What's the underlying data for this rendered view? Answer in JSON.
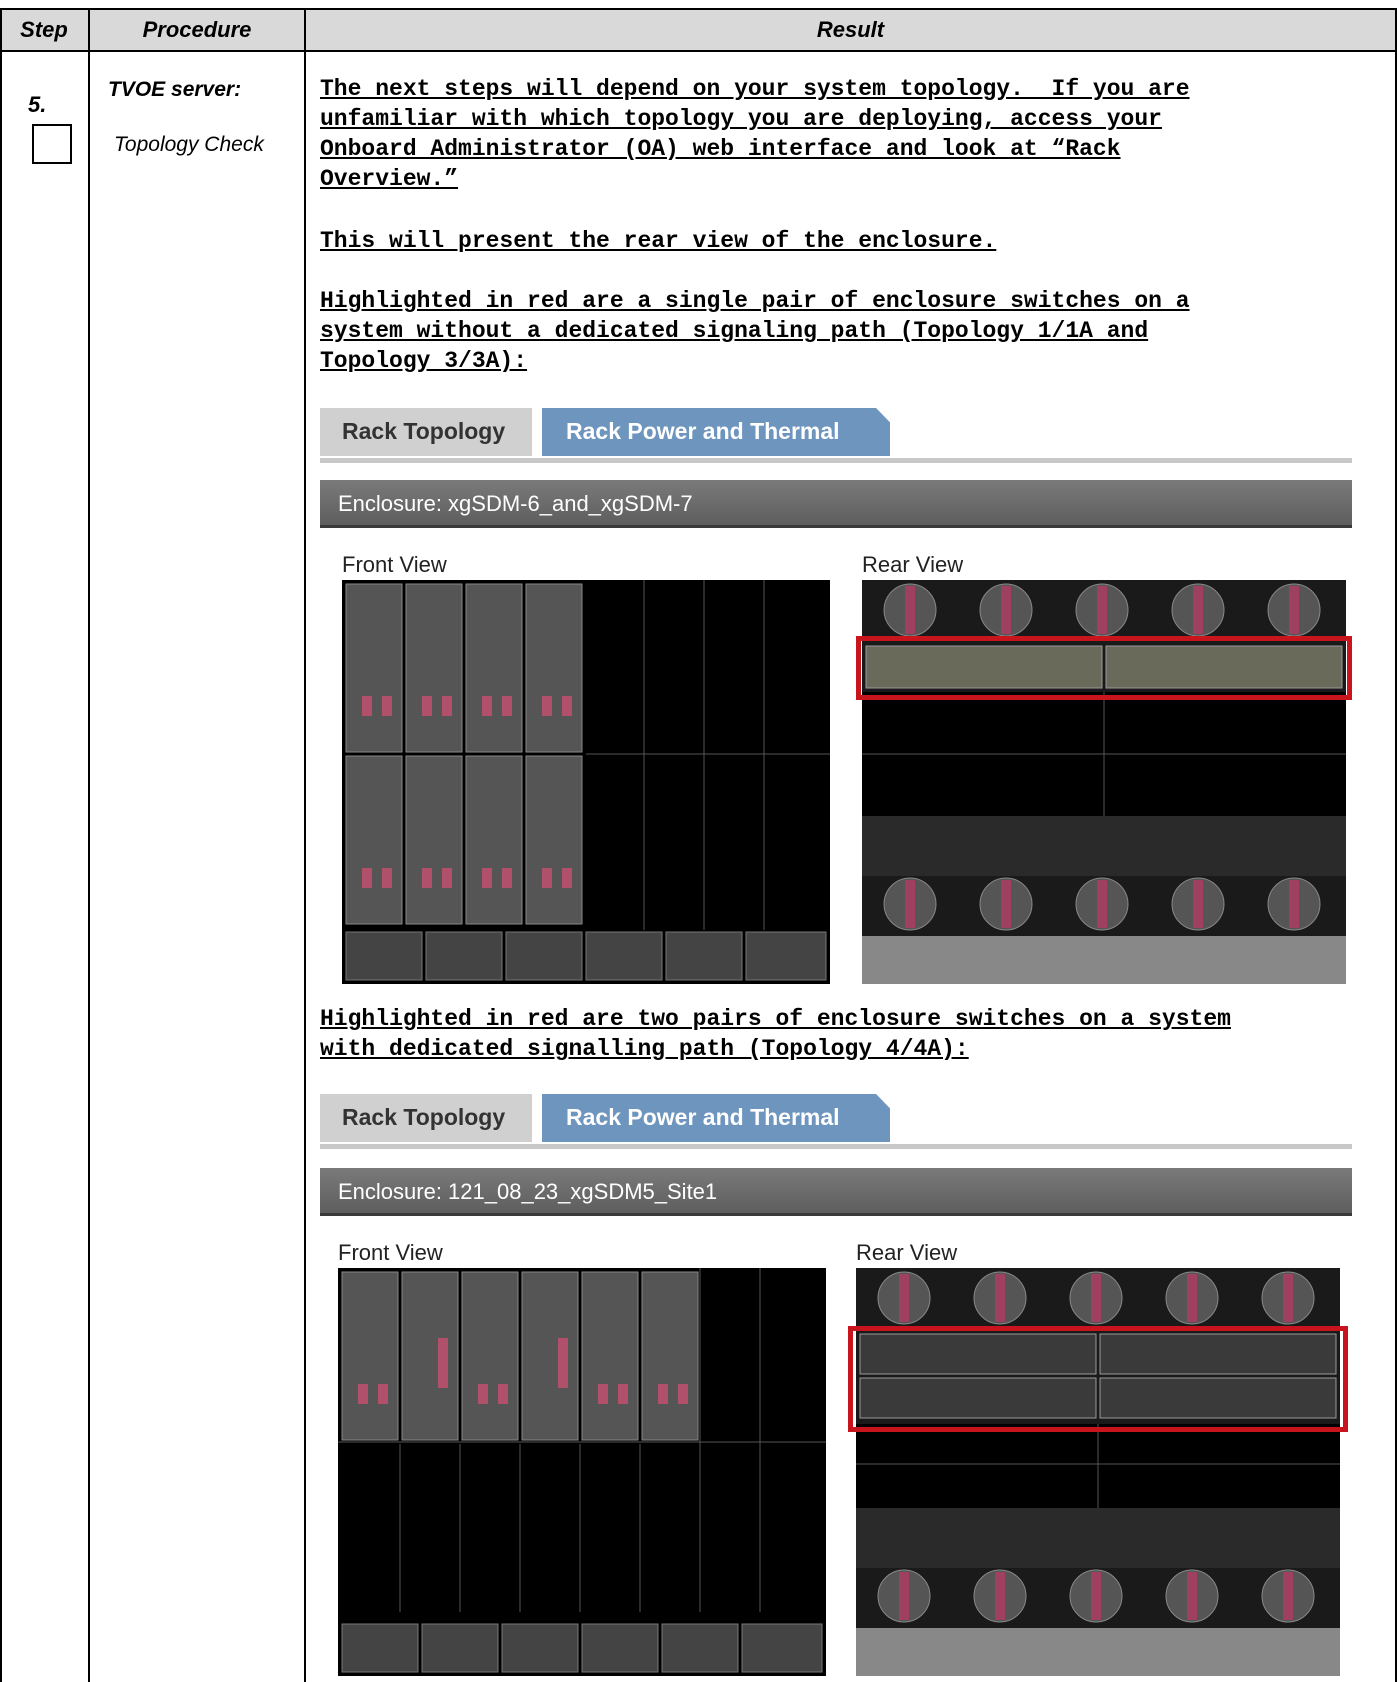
{
  "header": {
    "step": "Step",
    "procedure": "Procedure",
    "result": "Result"
  },
  "row": {
    "step_number": "5.",
    "procedure_title": "TVOE server:",
    "procedure_subtitle": "Topology Check"
  },
  "result": {
    "para1": "The next steps will depend on your system topology.  If you are\nunfamiliar with which topology you are deploying, access your\nOnboard Administrator (OA) web interface and look at “Rack\nOverview.”",
    "para2": "This will present the rear view of the enclosure.",
    "para3": "Highlighted in red are a single pair of enclosure switches on a\nsystem without a dedicated signaling path (Topology 1/1A and\nTopology 3/3A):",
    "para4": "Highlighted in red are two pairs of enclosure switches on a system\nwith dedicated signalling path (Topology 4/4A):"
  },
  "screenshots": [
    {
      "tab_active": "Rack Topology",
      "tab_other": "Rack Power and Thermal",
      "enclosure": "Enclosure: xgSDM-6_and_xgSDM-7",
      "front_label": "Front View",
      "rear_label": "Rear View"
    },
    {
      "tab_active": "Rack Topology",
      "tab_other": "Rack Power and Thermal",
      "enclosure": "Enclosure: 121_08_23_xgSDM5_Site1",
      "front_label": "Front View",
      "rear_label": "Rear View"
    }
  ]
}
